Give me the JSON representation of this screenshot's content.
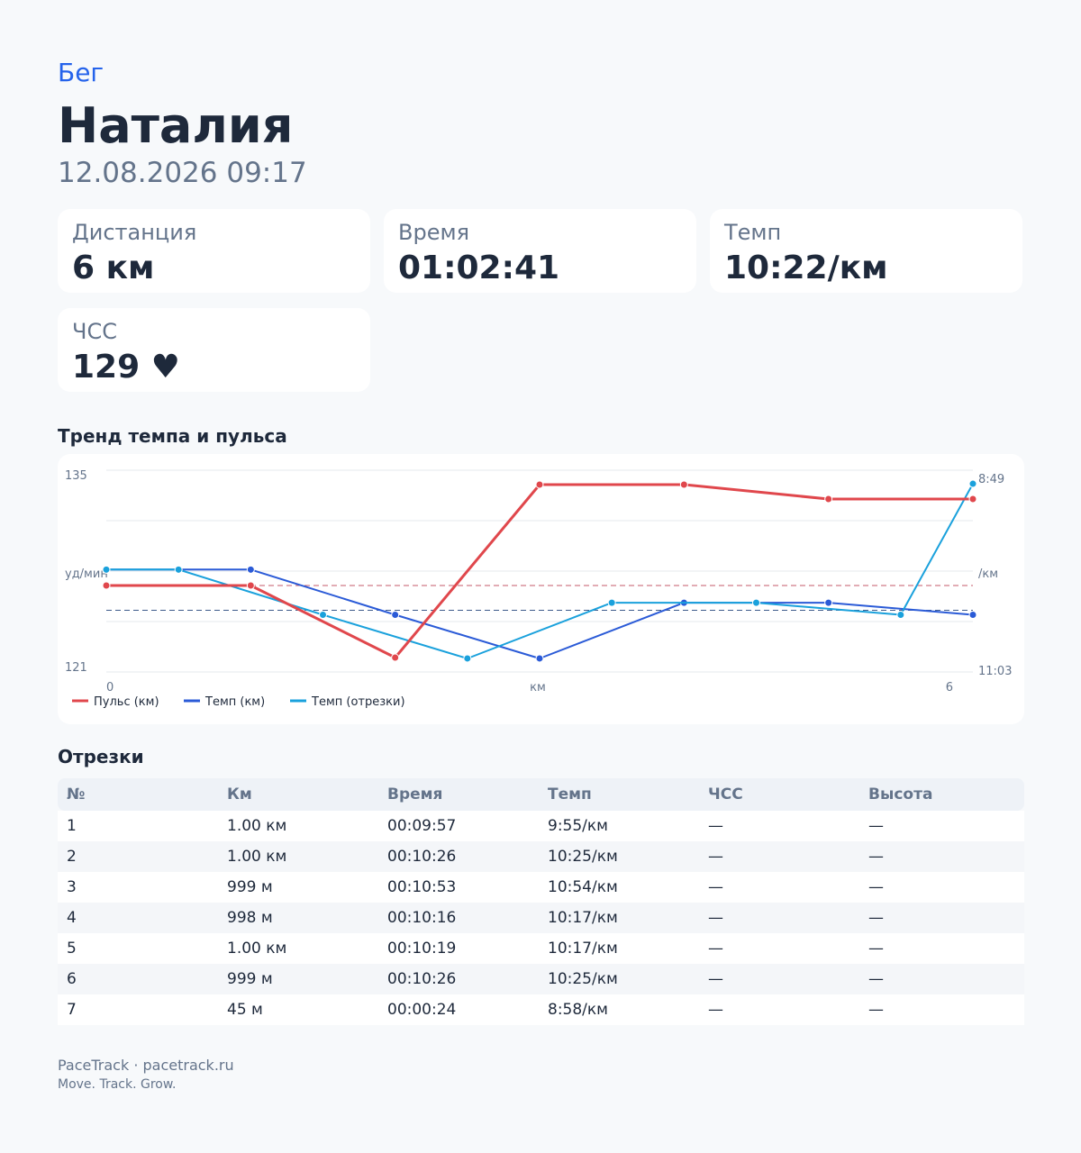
{
  "header": {
    "activity_type": "Бег",
    "athlete_name": "Наталия",
    "datetime": "12.08.2026 09:17"
  },
  "stats": [
    {
      "label": "Дистанция",
      "value": "6 км"
    },
    {
      "label": "Время",
      "value": "01:02:41"
    },
    {
      "label": "Темп",
      "value": "10:22/км"
    },
    {
      "label": "ЧСС",
      "value": "129 ♥"
    }
  ],
  "chart_section": {
    "title": "Тренд темпа и пульса"
  },
  "chart_data": {
    "type": "line",
    "xlabel": "км",
    "x_ticks": [
      "0",
      "6"
    ],
    "left_axis": {
      "label": "уд/мин",
      "min_label": "121",
      "max_label": "135",
      "range": [
        121,
        135
      ]
    },
    "right_axis": {
      "label": "/км",
      "top_label": "8:49",
      "bottom_label": "11:03",
      "range_seconds": [
        529,
        663
      ]
    },
    "grid": true,
    "legend_position": "bottom-left",
    "series": [
      {
        "name": "Пульс (км)",
        "axis": "left",
        "color": "#e0474c",
        "x": [
          0,
          1,
          2,
          3,
          4,
          5,
          6
        ],
        "values": [
          127,
          127,
          122,
          134,
          134,
          133,
          133
        ],
        "average": 127
      },
      {
        "name": "Темп (км)",
        "axis": "right",
        "color": "#2b5bd7",
        "x": [
          0,
          1,
          2,
          3,
          4,
          5,
          6
        ],
        "values_seconds": [
          595,
          595,
          625,
          654,
          617,
          617,
          625
        ],
        "values": [
          "9:55",
          "9:55",
          "10:25",
          "10:54",
          "10:17",
          "10:17",
          "10:25"
        ],
        "average_seconds": 622
      },
      {
        "name": "Темп (отрезки)",
        "axis": "right",
        "color": "#1aa1dc",
        "x": [
          0,
          0.5,
          1.5,
          2.5,
          3.5,
          4.5,
          5.5,
          6.0
        ],
        "values_seconds": [
          595,
          595,
          625,
          654,
          617,
          617,
          625,
          538
        ],
        "values": [
          "9:57",
          "9:57",
          "10:26",
          "10:53",
          "10:16",
          "10:19",
          "10:26",
          "8:58"
        ]
      }
    ]
  },
  "splits": {
    "title": "Отрезки",
    "headers": [
      "№",
      "Км",
      "Время",
      "Темп",
      "ЧСС",
      "Высота"
    ],
    "rows": [
      [
        "1",
        "1.00 км",
        "00:09:57",
        "9:55/км",
        "—",
        "—"
      ],
      [
        "2",
        "1.00 км",
        "00:10:26",
        "10:25/км",
        "—",
        "—"
      ],
      [
        "3",
        "999 м",
        "00:10:53",
        "10:54/км",
        "—",
        "—"
      ],
      [
        "4",
        "998 м",
        "00:10:16",
        "10:17/км",
        "—",
        "—"
      ],
      [
        "5",
        "1.00 км",
        "00:10:19",
        "10:17/км",
        "—",
        "—"
      ],
      [
        "6",
        "999 м",
        "00:10:26",
        "10:25/км",
        "—",
        "—"
      ],
      [
        "7",
        "45 м",
        "00:00:24",
        "8:58/км",
        "—",
        "—"
      ]
    ]
  },
  "footer": {
    "brand": "PaceTrack · pacetrack.ru",
    "tagline": "Move. Track. Grow."
  }
}
